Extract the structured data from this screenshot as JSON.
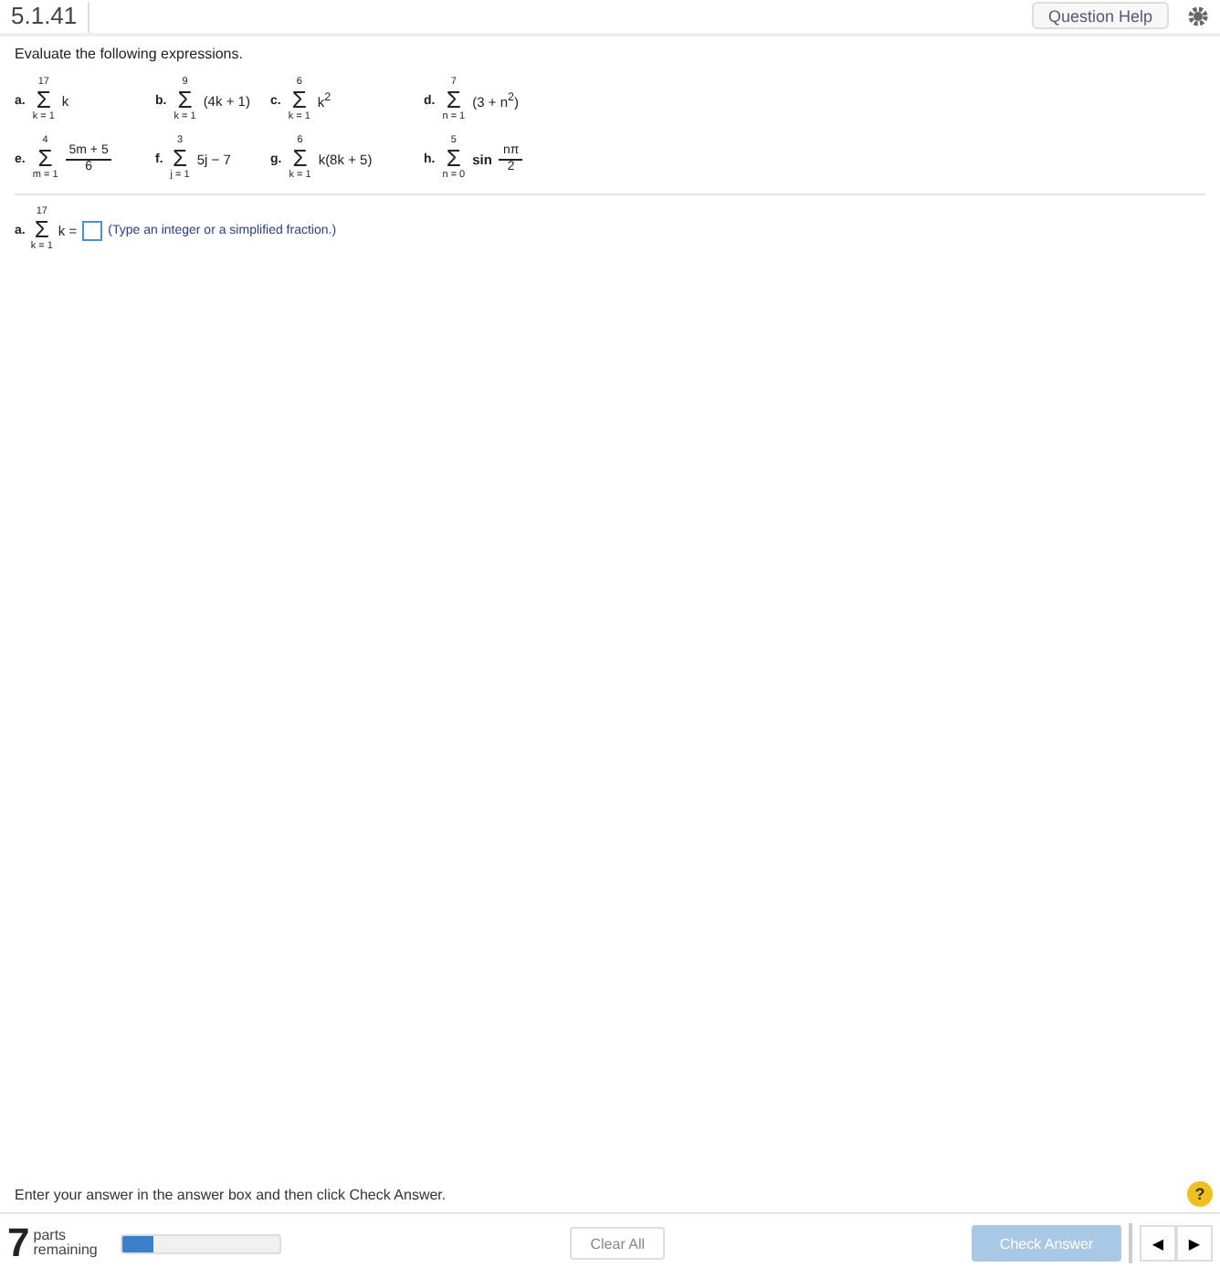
{
  "header": {
    "question_number": "5.1.41",
    "help_button": "Question Help"
  },
  "instruction": "Evaluate the following expressions.",
  "problems": [
    {
      "label": "a.",
      "upper": "17",
      "sigma": "Σ",
      "lower": "k = 1",
      "kind": "plain",
      "term": "k"
    },
    {
      "label": "b.",
      "upper": "9",
      "sigma": "Σ",
      "lower": "k = 1",
      "kind": "plain",
      "term": "(4k + 1)"
    },
    {
      "label": "c.",
      "upper": "6",
      "sigma": "Σ",
      "lower": "k = 1",
      "kind": "plain",
      "term": "k$^{2}$"
    },
    {
      "label": "d.",
      "upper": "7",
      "sigma": "Σ",
      "lower": "n = 1",
      "kind": "plain",
      "term": "(3 + n$^{2}$)"
    },
    {
      "label": "e.",
      "upper": "4",
      "sigma": "Σ",
      "lower": "m = 1",
      "kind": "fraction",
      "numerator": "5m + 5",
      "denominator": "6"
    },
    {
      "label": "f.",
      "upper": "3",
      "sigma": "Σ",
      "lower": "j = 1",
      "kind": "plain",
      "term": "5j − 7"
    },
    {
      "label": "g.",
      "upper": "6",
      "sigma": "Σ",
      "lower": "k = 1",
      "kind": "plain",
      "term": "k(8k + 5)"
    },
    {
      "label": "h.",
      "upper": "5",
      "sigma": "Σ",
      "lower": "n = 0",
      "kind": "function_fraction",
      "function": "sin",
      "numerator": "nπ",
      "denominator": "2"
    }
  ],
  "answer": {
    "label": "a.",
    "upper": "17",
    "sigma": "Σ",
    "lower": "k = 1",
    "term": "k =",
    "hint": "(Type an integer or a simplified fraction.)"
  },
  "footer": {
    "instruction": "Enter your answer in the answer box and then click Check Answer.",
    "help_icon": "?",
    "parts_count": "7",
    "parts_text": "parts remaining",
    "level": 0.2,
    "clear_button": "Clear All",
    "check_button": {
      "label": "Check Answer",
      "disabled": true
    },
    "prev": "◀",
    "next": "▶"
  }
}
